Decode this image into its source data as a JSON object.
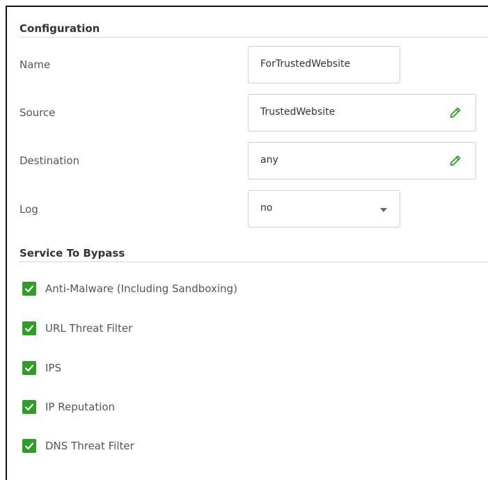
{
  "configuration": {
    "title": "Configuration",
    "name": {
      "label": "Name",
      "value": "ForTrustedWebsite"
    },
    "source": {
      "label": "Source",
      "value": "TrustedWebsite",
      "icon": "pencil-edit-icon"
    },
    "destination": {
      "label": "Destination",
      "value": "any",
      "icon": "pencil-edit-icon"
    },
    "log": {
      "label": "Log",
      "value": "no",
      "icon": "chevron-down-icon"
    }
  },
  "bypass": {
    "title": "Service To Bypass",
    "items": [
      {
        "label": "Anti-Malware (Including Sandboxing)",
        "checked": true
      },
      {
        "label": "URL Threat Filter",
        "checked": true
      },
      {
        "label": "IPS",
        "checked": true
      },
      {
        "label": "IP Reputation",
        "checked": true
      },
      {
        "label": "DNS Threat Filter",
        "checked": true
      }
    ]
  },
  "colors": {
    "accent": "#2f9e27",
    "border": "#cfcfcf",
    "text": "#555555"
  }
}
